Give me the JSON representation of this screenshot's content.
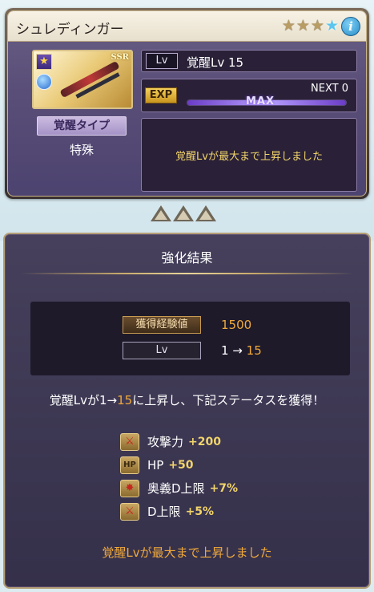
{
  "weapon": {
    "name": "シュレディンガー",
    "rarity_badge": "SSR",
    "star_icons": [
      "★",
      "★",
      "★",
      "★"
    ],
    "awaken_type_label": "覚醒タイプ",
    "awaken_type_value": "特殊",
    "lv_tag": "Lv",
    "lv_text": "覚醒Lv 15",
    "exp_tag": "EXP",
    "next_text": "NEXT 0",
    "exp_bar_label": "MAX",
    "exp_progress": 1.0,
    "message": "覚醒Lvが最大まで上昇しました"
  },
  "result": {
    "title": "強化結果",
    "gain_label": "獲得経験値",
    "gain_value": "1500",
    "lv_label": "Lv",
    "lv_from": "1 → ",
    "lv_to": "15",
    "summary_prefix": "覚醒Lvが1→",
    "summary_to": "15",
    "summary_suffix": "に上昇し、下記ステータスを獲得！",
    "stats": [
      {
        "name": "攻撃力",
        "value": "+200",
        "icon": "attack-icon"
      },
      {
        "name": "HP",
        "value": "+50",
        "icon": "hp-icon"
      },
      {
        "name": "奥義D上限",
        "value": "+7%",
        "icon": "ougi-icon"
      },
      {
        "name": "D上限",
        "value": "+5%",
        "icon": "damage-cap-icon"
      }
    ],
    "max_message": "覚醒Lvが最大まで上昇しました"
  },
  "colors": {
    "accent_gold": "#f0a93c",
    "text_yellow": "#f1d46a",
    "panel_purple": "#46405c"
  }
}
